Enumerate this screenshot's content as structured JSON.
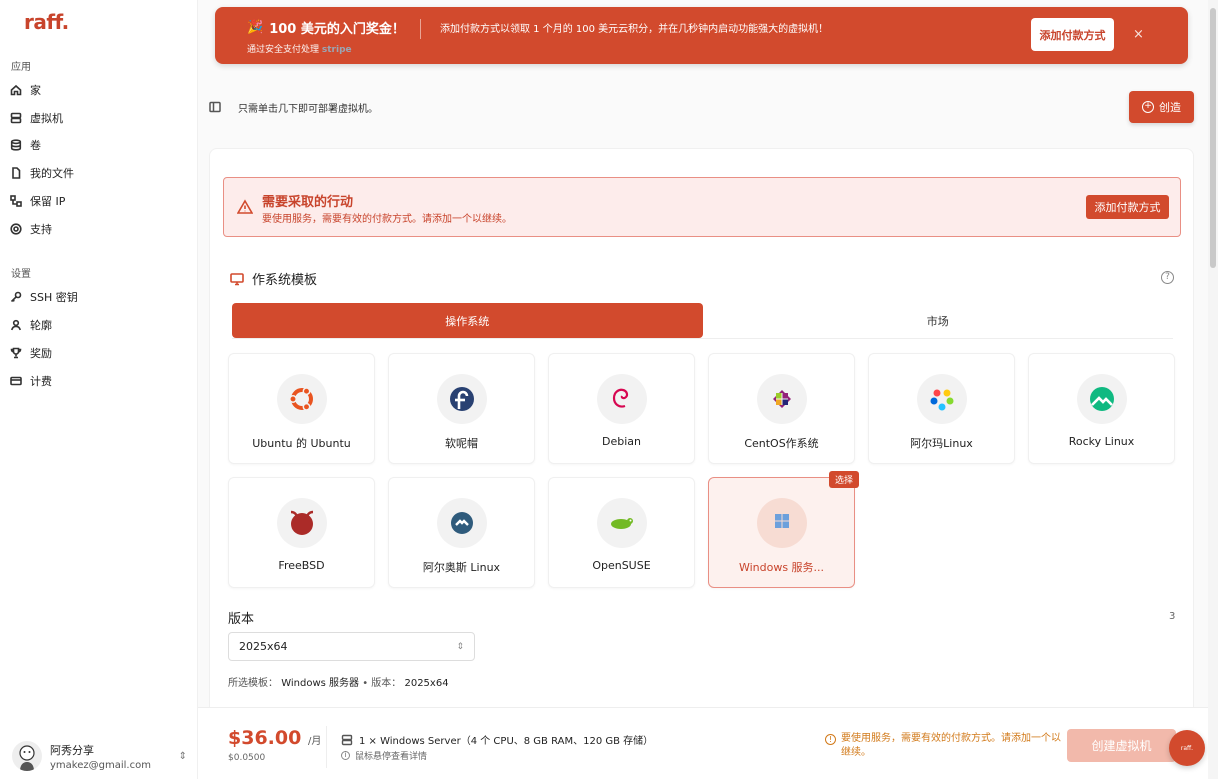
{
  "app": {
    "logo": "raff."
  },
  "sidebar": {
    "section_apps": "应用",
    "apps": [
      {
        "label": "家",
        "icon": "home-icon"
      },
      {
        "label": "虚拟机",
        "icon": "server-icon"
      },
      {
        "label": "卷",
        "icon": "database-icon"
      },
      {
        "label": "我的文件",
        "icon": "file-icon"
      },
      {
        "label": "保留 IP",
        "icon": "network-icon"
      },
      {
        "label": "支持",
        "icon": "lifebuoy-icon"
      }
    ],
    "section_settings": "设置",
    "settings": [
      {
        "label": "SSH 密钥",
        "icon": "key-icon"
      },
      {
        "label": "轮廓",
        "icon": "user-icon"
      },
      {
        "label": "奖励",
        "icon": "trophy-icon"
      },
      {
        "label": "计费",
        "icon": "credit-card-icon"
      }
    ],
    "user": {
      "name": "阿秀分享",
      "email": "ymakez@gmail.com"
    }
  },
  "promo": {
    "title": "100 美元的入门奖金！",
    "subtitle": "通过安全支付处理",
    "subtitle_brand": "stripe",
    "text": "添加付款方式以领取 1 个月的 100 美元云积分，并在几秒钟内启动功能强大的虚拟机！",
    "button": "添加付款方式",
    "close": "×"
  },
  "toolbar": {
    "hint": "只需单击几下即可部署虚拟机。",
    "create": "创造"
  },
  "alert": {
    "title": "需要采取的行动",
    "text": "要使用服务，需要有效的付款方式。请添加一个以继续。",
    "button": "添加付款方式"
  },
  "templates": {
    "title": "作系统模板",
    "help": "?",
    "tabs": [
      {
        "label": "操作系统",
        "active": true
      },
      {
        "label": "市场",
        "active": false
      }
    ],
    "os": [
      {
        "label": "Ubuntu 的 Ubuntu",
        "key": "ubuntu"
      },
      {
        "label": "软呢帽",
        "key": "fedora"
      },
      {
        "label": "Debian",
        "key": "debian"
      },
      {
        "label": "CentOS作系统",
        "key": "centos"
      },
      {
        "label": "阿尔玛Linux",
        "key": "alma"
      },
      {
        "label": "Rocky Linux",
        "key": "rocky"
      },
      {
        "label": "FreeBSD",
        "key": "freebsd"
      },
      {
        "label": "阿尔奥斯 Linux",
        "key": "arch"
      },
      {
        "label": "OpenSUSE",
        "key": "opensuse"
      },
      {
        "label": "Windows 服务...",
        "key": "windows",
        "selected": true
      }
    ],
    "selected_badge": "选择"
  },
  "version": {
    "title": "版本",
    "count": "3",
    "selected": "2025x64",
    "summary_prefix": "所选模板：",
    "summary_template": "Windows 服务器",
    "summary_mid": " • 版本：",
    "summary_version": "2025x64"
  },
  "footer": {
    "price": "$36.00",
    "unit": "/月",
    "hourly": "$0.0500",
    "spec": "1 × Windows Server（4 个 CPU、8 GB RAM、120 GB 存储）",
    "spec_hint": "鼠标悬停查看详情",
    "warning": "要使用服务，需要有效的付款方式。请添加一个以继续。",
    "create_vm": "创建虚拟机",
    "chat": "raff."
  },
  "colors": {
    "brand": "#d24a2d",
    "warning": "#d27a1a"
  }
}
